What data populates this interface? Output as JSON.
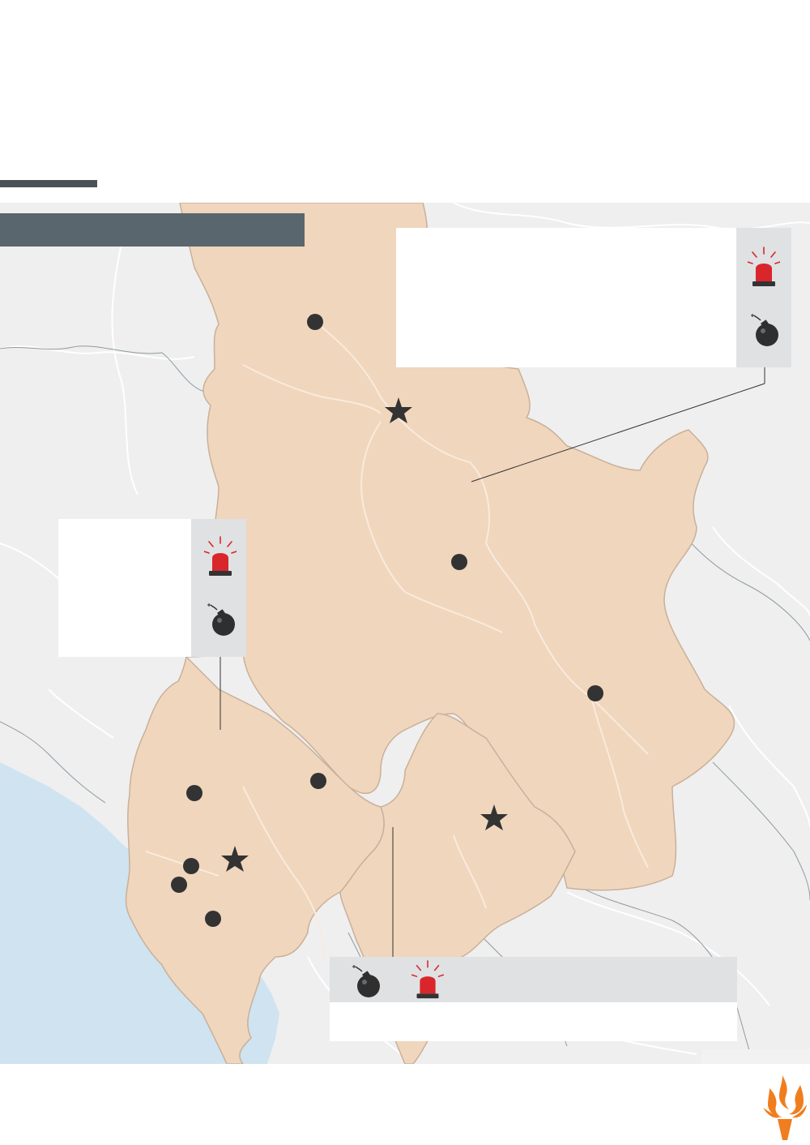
{
  "header": {
    "title": ""
  },
  "callouts": [
    {
      "id": "north",
      "text": ""
    },
    {
      "id": "west",
      "text": ""
    },
    {
      "id": "south",
      "text": ""
    }
  ],
  "legend": {
    "siren_icon": "siren-icon",
    "bomb_icon": "bomb-icon"
  },
  "colors": {
    "territory": "#f0d6bd",
    "territory_border": "#c9b09a",
    "sea": "#cfe3f0",
    "land": "#efefef",
    "roads": "#ffffff",
    "header_bar": "#5a666e",
    "marker": "#333333",
    "siren": "#d9262b",
    "logo": "#f07d1e"
  }
}
